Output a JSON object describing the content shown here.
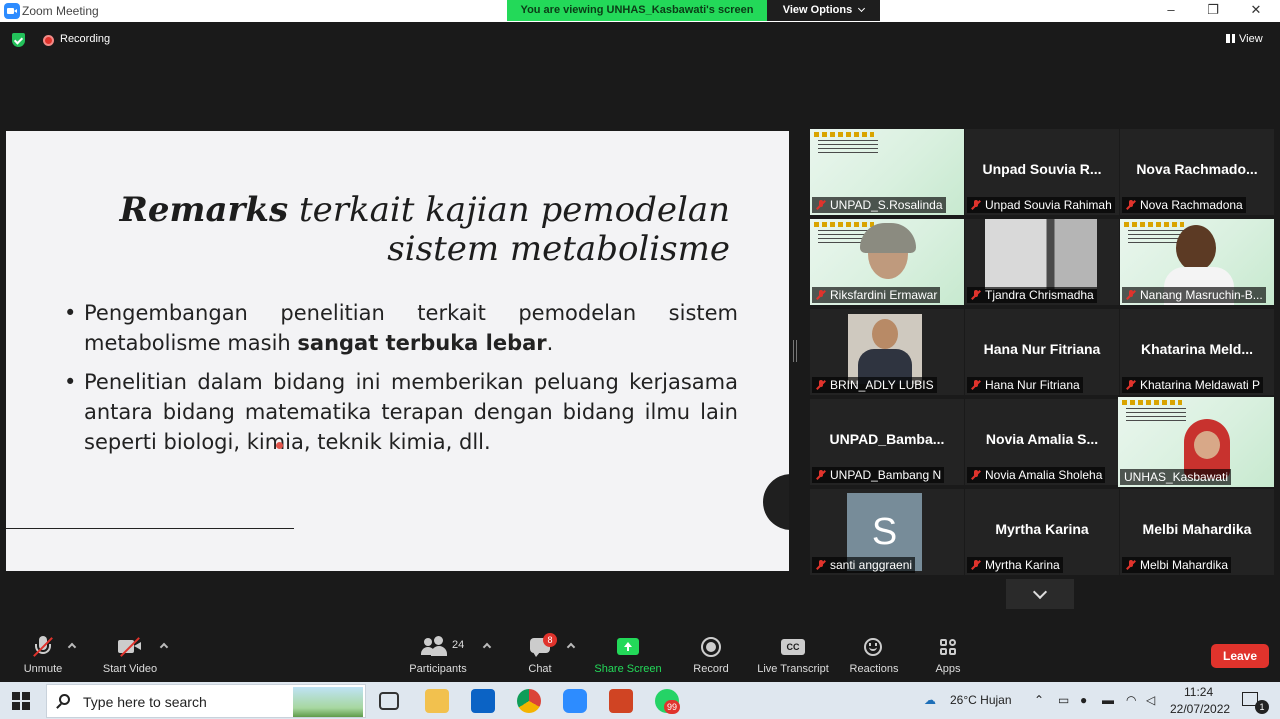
{
  "window": {
    "title": "Zoom Meeting",
    "viewing_banner": "You are viewing UNHAS_Kasbawati's screen",
    "view_options": "View Options",
    "min": "–",
    "max": "❐",
    "close": "✕"
  },
  "status": {
    "recording": "Recording",
    "view": "View"
  },
  "slide": {
    "title_bold": "Remarks",
    "title_rest": " terkait kajian pemodelan sistem metabolisme",
    "bullet1_a": "Pengembangan penelitian terkait pemodelan sistem metabolisme masih ",
    "bullet1_bold": "sangat terbuka lebar",
    "bullet1_b": ".",
    "bullet2": "Penelitian dalam bidang ini memberikan peluang kerjasama antara bidang matematika terapan dengan bidang ilmu lain seperti biologi, kimia, teknik kimia, dll."
  },
  "participants": [
    {
      "label": "UNPAD_S.Rosalinda"
    },
    {
      "name": "Unpad Souvia R...",
      "label": "Unpad Souvia Rahimah"
    },
    {
      "name": "Nova  Rachmado...",
      "label": "Nova Rachmadona"
    },
    {
      "label": "Riksfardini Ermawar"
    },
    {
      "label": "Tjandra Chrismadha"
    },
    {
      "label": "Nanang Masruchin-B..."
    },
    {
      "label": "BRIN_ADLY LUBIS"
    },
    {
      "name": "Hana Nur Fitriana",
      "label": "Hana Nur Fitriana"
    },
    {
      "name": "Khatarina  Meld...",
      "label": "Khatarina Meldawati P"
    },
    {
      "name": "UNPAD_Bamba...",
      "label": "UNPAD_Bambang N"
    },
    {
      "name": "Novia Amalia S...",
      "label": "Novia Amalia Sholeha"
    },
    {
      "label": "UNHAS_Kasbawati"
    },
    {
      "initial": "S",
      "label": "santi anggraeni"
    },
    {
      "name": "Myrtha Karina",
      "label": "Myrtha Karina"
    },
    {
      "name": "Melbi Mahardika",
      "label": "Melbi Mahardika"
    }
  ],
  "toolbar": {
    "unmute": "Unmute",
    "start_video": "Start Video",
    "participants": "Participants",
    "participants_count": "24",
    "chat": "Chat",
    "chat_badge": "8",
    "share_screen": "Share Screen",
    "record": "Record",
    "live_transcript": "Live Transcript",
    "cc": "CC",
    "reactions": "Reactions",
    "apps": "Apps",
    "leave": "Leave"
  },
  "taskbar": {
    "search_placeholder": "Type here to search",
    "weather": "26°C  Hujan",
    "time": "11:24",
    "date": "22/07/2022",
    "whatsapp_badge": "99",
    "notif_count": "1"
  },
  "colors": {
    "banner_green": "#23d959",
    "share_green": "#23d959",
    "leave_red": "#e0332c",
    "active_speaker": "#e8f545"
  }
}
